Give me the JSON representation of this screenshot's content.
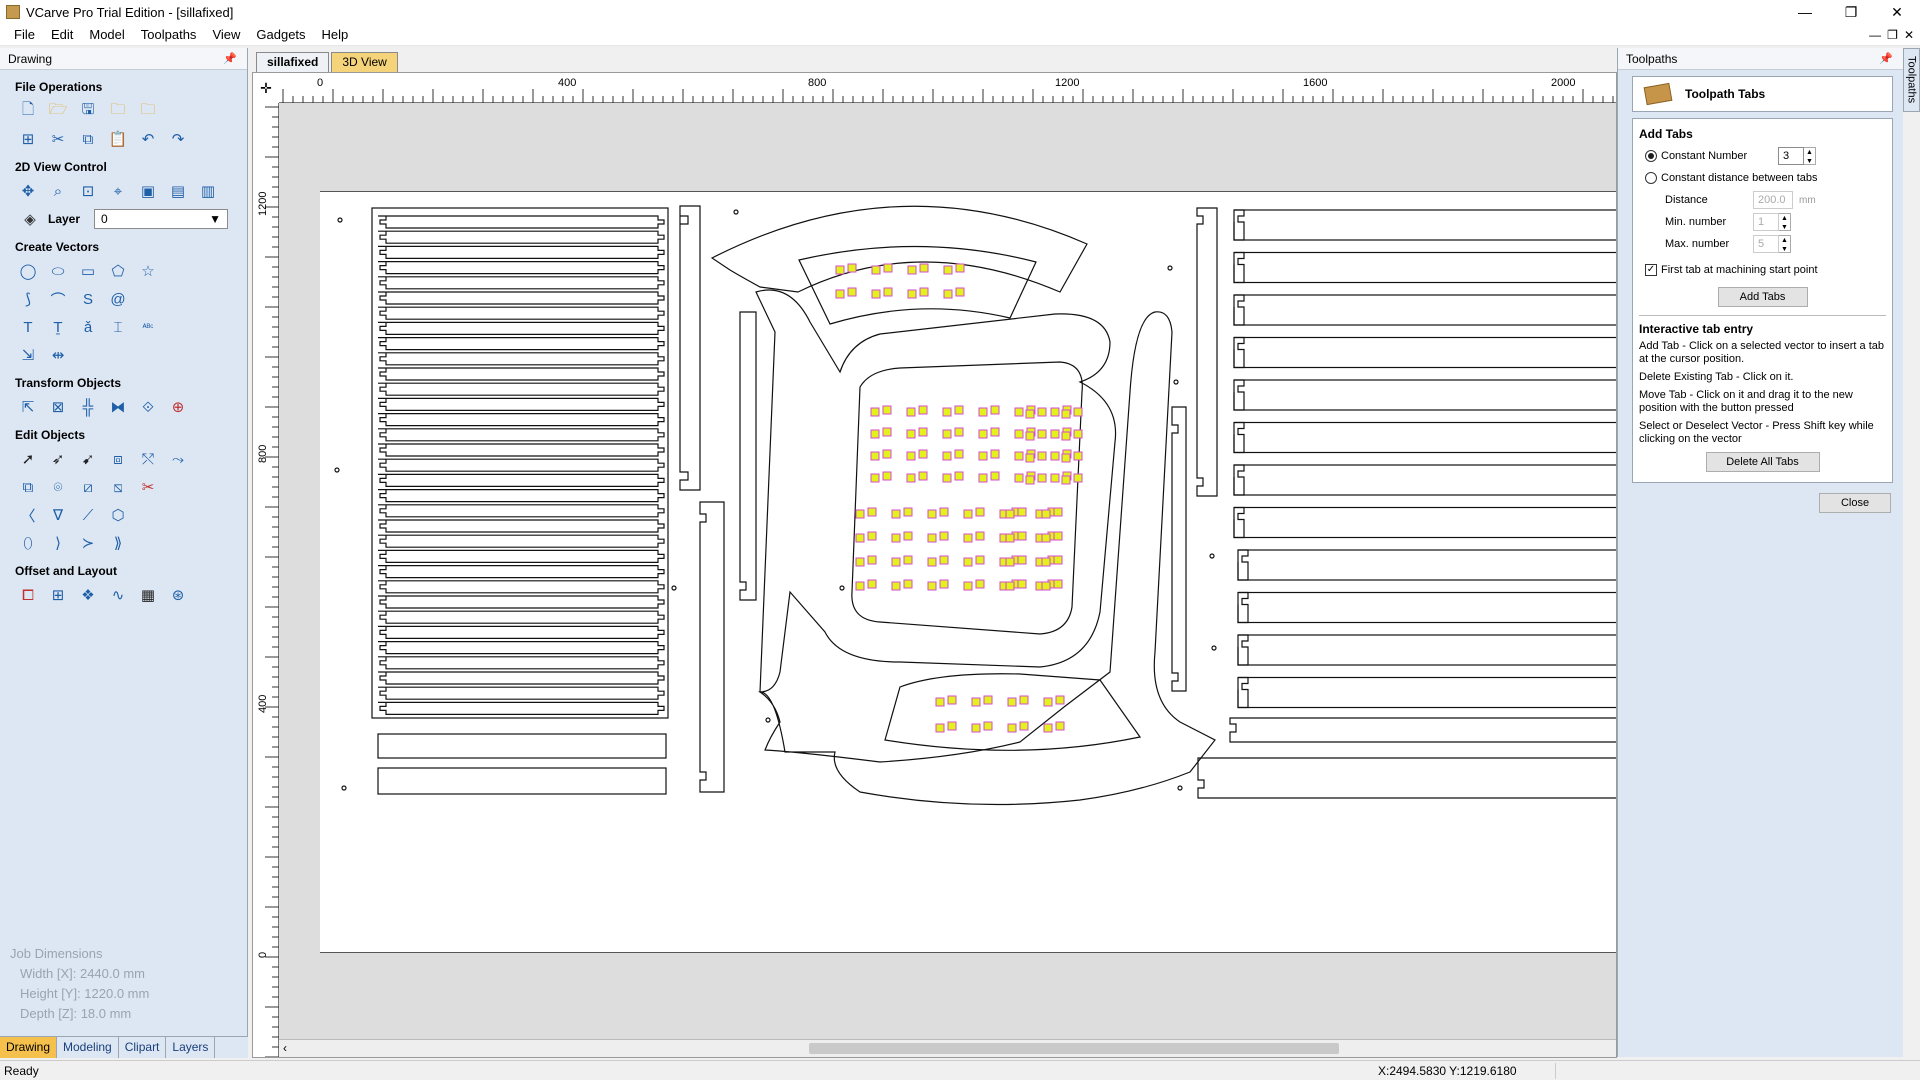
{
  "window": {
    "title": "VCarve Pro Trial Edition - [sillafixed]",
    "controls": [
      "—",
      "❐",
      "✕"
    ],
    "mdi_controls": [
      "—",
      "❐",
      "✕"
    ]
  },
  "menu": [
    "File",
    "Edit",
    "Model",
    "Toolpaths",
    "View",
    "Gadgets",
    "Help"
  ],
  "left_panel": {
    "header": "Drawing",
    "sections": {
      "file_ops": "File Operations",
      "view_control": "2D View Control",
      "create_vectors": "Create Vectors",
      "transform": "Transform Objects",
      "edit_objects": "Edit Objects",
      "offset_layout": "Offset and Layout"
    },
    "layer_label": "Layer",
    "layer_value": "0",
    "job_dimensions": {
      "title": "Job Dimensions",
      "width": "Width  [X]: 2440.0 mm",
      "height": "Height [Y]: 1220.0 mm",
      "depth": "Depth  [Z]: 18.0 mm"
    },
    "tabs": [
      "Drawing",
      "Modeling",
      "Clipart",
      "Layers"
    ]
  },
  "document": {
    "tabs": [
      "sillafixed",
      "3D View"
    ],
    "ruler_h_labels": [
      "0",
      "400",
      "800",
      "1200",
      "1600",
      "2000"
    ],
    "ruler_v_labels": [
      "1200",
      "800",
      "400",
      "0"
    ]
  },
  "right_panel": {
    "header": "Toolpaths",
    "side_tab": "Toolpaths",
    "title": "Toolpath Tabs",
    "add_tabs_heading": "Add Tabs",
    "constant_number_label": "Constant Number",
    "constant_number_value": "3",
    "constant_distance_label": "Constant distance between tabs",
    "distance_label": "Distance",
    "distance_value": "200.0",
    "distance_unit": "mm",
    "min_label": "Min. number",
    "min_value": "1",
    "max_label": "Max. number",
    "max_value": "5",
    "first_tab_label": "First tab at machining start point",
    "add_tabs_button": "Add Tabs",
    "interactive_heading": "Interactive tab entry",
    "help_add": "Add Tab - Click on a selected vector to insert a tab at the cursor position.",
    "help_delete": "Delete Existing Tab - Click on it.",
    "help_move": "Move Tab - Click on it and drag it to the new position with the button pressed",
    "help_select": "Select or Deselect Vector - Press Shift key while clicking on the vector",
    "delete_all_button": "Delete All Tabs",
    "close_button": "Close"
  },
  "status": {
    "left": "Ready",
    "coords": "X:2494.5830 Y:1219.6180"
  },
  "icons": {
    "file_ops_row1": [
      "new-file-icon",
      "open-file-icon",
      "save-icon",
      "import-icon",
      "open-folder-icon"
    ],
    "file_ops_row2": [
      "select-all-icon",
      "cut-icon",
      "copy-icon",
      "paste-icon",
      "undo-icon",
      "redo-icon"
    ],
    "view_row": [
      "pan-icon",
      "zoom-icon",
      "zoom-extents-icon",
      "zoom-box-icon",
      "view-a-icon",
      "view-b-icon",
      "view-c-icon"
    ],
    "vectors_row1": [
      "circle-icon",
      "ellipse-icon",
      "rectangle-icon",
      "polygon-icon",
      "star-icon"
    ],
    "vectors_row2": [
      "polyline-icon",
      "arc-icon",
      "curve-icon",
      "spiral-icon"
    ],
    "vectors_row3": [
      "text-icon",
      "text-box-icon",
      "text-on-curve-icon",
      "text-autolayout-icon",
      "abc-icon"
    ],
    "vectors_row4": [
      "dimension-icon",
      "measure-icon"
    ],
    "transform_row": [
      "move-icon",
      "scale-icon",
      "align-icon",
      "mirror-icon",
      "distort-icon",
      "center-icon"
    ],
    "edit_row1": [
      "select-icon",
      "node-edit-icon",
      "transform-icon",
      "group-icon",
      "ungroup-icon",
      "trim-icon"
    ],
    "edit_row2": [
      "weld-icon",
      "join-icon",
      "subtract-icon",
      "intersect-icon",
      "scissors-icon"
    ],
    "edit_row3": [
      "fillet-icon",
      "chamfer-icon",
      "extend-icon",
      "close-vector-icon"
    ],
    "edit_row4": [
      "smooth-icon",
      "fit-curve-icon",
      "break-icon",
      "connect-icon"
    ],
    "offset_row": [
      "offset-icon",
      "array-icon",
      "nest-icon",
      "copy-along-icon",
      "block-copy-icon",
      "circular-array-icon"
    ]
  },
  "colors": {
    "panel_bg": "#dde7f3",
    "active_tab": "#f5c04c",
    "tab_marker_fill": "#e3f21c",
    "tab_marker_stroke": "#d64bd3"
  }
}
